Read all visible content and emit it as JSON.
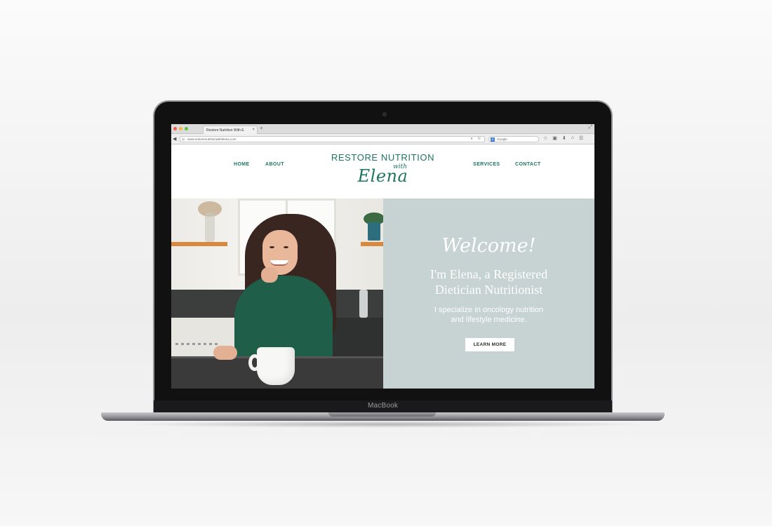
{
  "laptop": {
    "brand": "MacBook"
  },
  "browser": {
    "tab_title": "Restore Nutrition With E",
    "tab_close": "×",
    "new_tab": "+",
    "url": "www.restorenutritionwithelena.com",
    "search_placeholder": "Google",
    "search_engine_badge": "8",
    "icons": [
      "back-icon",
      "globe-icon",
      "reload-icon",
      "google-search-icon",
      "star-icon",
      "camera-icon",
      "download-icon",
      "home-icon",
      "menu-icon",
      "fullscreen-icon"
    ]
  },
  "site": {
    "nav": {
      "home": "HOME",
      "about": "ABOUT",
      "services": "SERVICES",
      "contact": "CONTACT"
    },
    "logo": {
      "top": "RESTORE NUTRITION",
      "with": "with",
      "name": "Elena"
    },
    "hero": {
      "welcome": "Welcome!",
      "intro_line1": "I'm Elena, a Registered",
      "intro_line2": "Dietician Nutritionist",
      "specialty_line1": "I specialize in oncology nutrition",
      "specialty_line2": "and lifestyle medicine.",
      "button": "LEARN MORE"
    },
    "colors": {
      "brand_green": "#1e7560",
      "hero_panel": "#c7d2d2"
    }
  }
}
